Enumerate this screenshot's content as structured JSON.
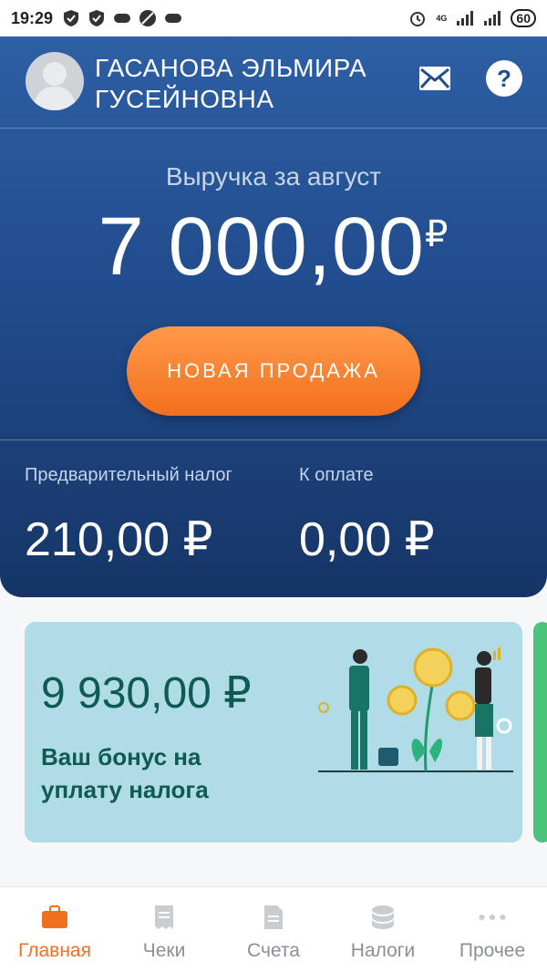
{
  "status_bar": {
    "time": "19:29",
    "network": "4G",
    "battery": "60"
  },
  "header": {
    "user_name_line1": "ГАСАНОВА ЭЛЬМИРА",
    "user_name_line2": "ГУСЕЙНОВНА",
    "help_label": "?"
  },
  "revenue": {
    "label": "Выручка за август",
    "amount": "7 000,00",
    "currency": "₽"
  },
  "new_sale_button": "НОВАЯ ПРОДАЖА",
  "taxes": {
    "prelim_label": "Предварительный налог",
    "prelim_value": "210,00 ₽",
    "due_label": "К оплате",
    "due_value": "0,00 ₽"
  },
  "bonus": {
    "amount": "9 930,00 ₽",
    "text": "Ваш бонус на уплату налога"
  },
  "nav": {
    "items": [
      {
        "label": "Главная",
        "icon": "briefcase-icon",
        "active": true
      },
      {
        "label": "Чеки",
        "icon": "receipt-icon",
        "active": false
      },
      {
        "label": "Счета",
        "icon": "document-icon",
        "active": false
      },
      {
        "label": "Налоги",
        "icon": "coins-icon",
        "active": false
      },
      {
        "label": "Прочее",
        "icon": "more-icon",
        "active": false
      }
    ]
  },
  "colors": {
    "accent": "#f07020",
    "header_blue": "#214c8d",
    "bonus_bg": "#afdce6",
    "bonus_text": "#0f5a55"
  }
}
